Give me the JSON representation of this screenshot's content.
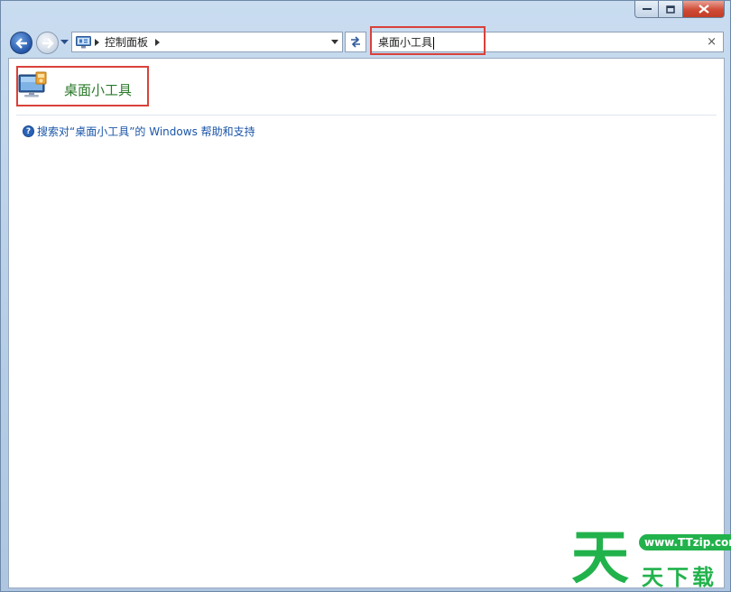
{
  "window": {
    "caption_buttons": {
      "minimize": "minimize-icon",
      "maximize": "maximize-icon",
      "close": "close-icon"
    }
  },
  "navigation": {
    "address": {
      "icon": "control-panel-icon",
      "path": [
        "控制面板"
      ]
    },
    "search": {
      "value": "桌面小工具"
    }
  },
  "results": [
    {
      "title": "桌面小工具",
      "icon": "desktop-gadgets-icon"
    }
  ],
  "help": {
    "text": "搜索对“桌面小工具”的 Windows 帮助和支持"
  },
  "watermark": {
    "big_char": "天",
    "url": "www.TTzip.com",
    "name": "天下载"
  },
  "colors": {
    "highlight": "#d9413a",
    "result_title": "#2b7a2b",
    "link": "#1a55a8",
    "watermark": "#22b24c"
  }
}
